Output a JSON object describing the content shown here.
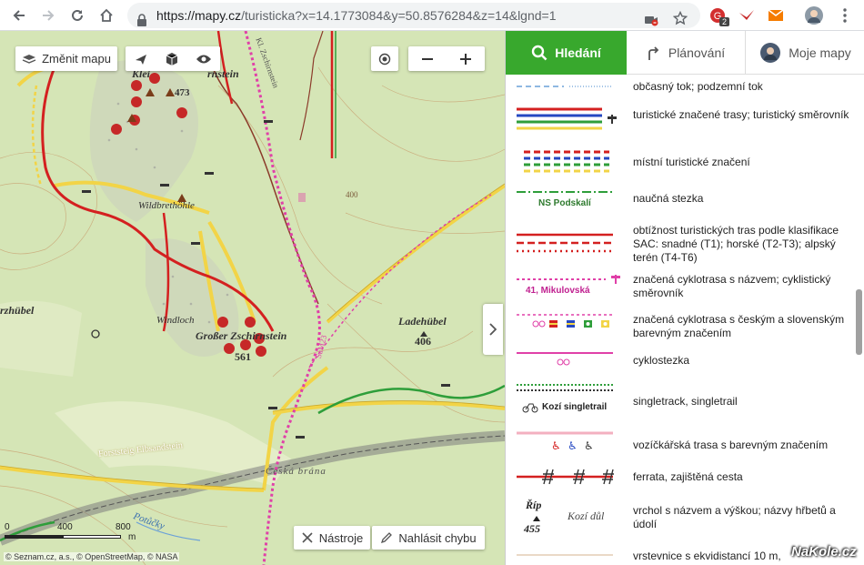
{
  "browser": {
    "url_host": "https://mapy.cz",
    "url_rest": "/turisticka?x=14.1773084&y=50.8576284&z=14&lgnd=1",
    "ext_badge": "2"
  },
  "map": {
    "change_map_label": "Změnit mapu",
    "tools_label": "Nástroje",
    "report_label": "Nahlásit chybu",
    "attribution": "© Seznam.cz, a.s., © OpenStreetMap, © NASA",
    "scale": {
      "s0": "0",
      "s400": "400",
      "s800": "800",
      "unit": "m"
    },
    "places": {
      "kleiner": "Kleiner Zschirnstein",
      "kleiner_short": "Klei",
      "kleiner_end": "rnstein",
      "elev473": "473",
      "wildbret": "Wildbrethöhle",
      "windloch": "Windloch",
      "grosser": "Großer Zschirnstein",
      "elev561": "561",
      "ladehubel": "Ladehübel",
      "elev406": "406",
      "zhubel": "rzhübel",
      "forststeig": "Forststeig Elbsandstein",
      "ceskabrana": "Česká brána",
      "poticky": "Potůčky",
      "contour400": "400",
      "ki_zsch": "Kl. Zschirnstein",
      "sam23": "SaM23"
    }
  },
  "panel": {
    "tabs": {
      "search": "Hledání",
      "plan": "Plánování",
      "mymaps": "Moje mapy"
    },
    "legend": [
      {
        "text": "občasný tok; podzemní tok"
      },
      {
        "text": "turistické značené trasy; turistický směrovník"
      },
      {
        "text": "místní turistické značení"
      },
      {
        "text": "naučná stezka",
        "sym": "NS Podskalí"
      },
      {
        "text": "obtížnost turistických tras podle klasifikace SAC: snadné (T1); horské (T2-T3); alpský terén (T4-T6)"
      },
      {
        "text": "značená cyklotrasa s názvem; cyklistický směrovník",
        "sym": "41, Mikulovská"
      },
      {
        "text": "značená cyklotrasa s českým a slovenským barevným značením"
      },
      {
        "text": "cyklostezka"
      },
      {
        "text": "singletrack, singletrail",
        "sym": "Kozí singletrail"
      },
      {
        "text": "vozíčkářská trasa s barevným značením"
      },
      {
        "text": "ferrata, zajištěná cesta"
      },
      {
        "text": "vrchol s názvem a výškou; názvy hřbetů a údolí",
        "sym_peak": "Říp",
        "sym_elev": "455",
        "sym_ridge": "Kozí důl"
      },
      {
        "text": "vrstevnice s ekvidistancí 10 m,"
      }
    ]
  },
  "watermark": "NaKole.cz"
}
